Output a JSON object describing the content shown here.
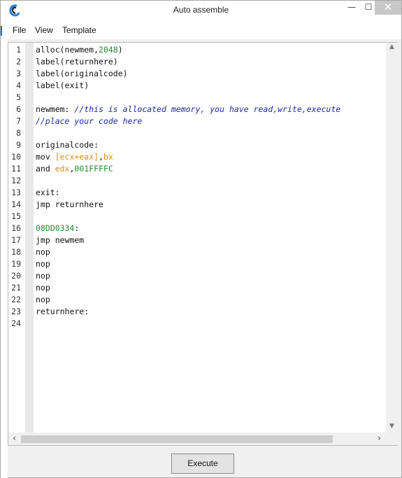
{
  "window": {
    "title": "Auto assemble",
    "min_glyph": "—",
    "max_glyph": "☐",
    "close_glyph": "✕"
  },
  "menu": [
    "File",
    "View",
    "Template"
  ],
  "editor": {
    "lines": [
      {
        "n": "1",
        "segs": [
          {
            "t": "alloc(newmem,",
            "c": "plain"
          },
          {
            "t": "2048",
            "c": "num"
          },
          {
            "t": ")",
            "c": "plain"
          }
        ]
      },
      {
        "n": "2",
        "segs": [
          {
            "t": "label(returnhere)",
            "c": "plain"
          }
        ]
      },
      {
        "n": "3",
        "segs": [
          {
            "t": "label(originalcode)",
            "c": "plain"
          }
        ]
      },
      {
        "n": "4",
        "segs": [
          {
            "t": "label(exit)",
            "c": "plain"
          }
        ]
      },
      {
        "n": "5",
        "segs": []
      },
      {
        "n": "6",
        "segs": [
          {
            "t": "newmem: ",
            "c": "plain"
          },
          {
            "t": "//this is allocated memory, you have read,write,execute",
            "c": "comment"
          }
        ]
      },
      {
        "n": "7",
        "segs": [
          {
            "t": "//place your code here",
            "c": "comment"
          }
        ]
      },
      {
        "n": "8",
        "segs": []
      },
      {
        "n": "9",
        "segs": [
          {
            "t": "originalcode:",
            "c": "plain"
          }
        ]
      },
      {
        "n": "10",
        "segs": [
          {
            "t": "mov ",
            "c": "plain"
          },
          {
            "t": "[ecx+eax]",
            "c": "reg"
          },
          {
            "t": ",",
            "c": "plain"
          },
          {
            "t": "bx",
            "c": "reg"
          }
        ]
      },
      {
        "n": "11",
        "segs": [
          {
            "t": "and ",
            "c": "plain"
          },
          {
            "t": "edx",
            "c": "reg"
          },
          {
            "t": ",",
            "c": "plain"
          },
          {
            "t": "001FFFFC",
            "c": "num"
          }
        ]
      },
      {
        "n": "12",
        "segs": []
      },
      {
        "n": "13",
        "segs": [
          {
            "t": "exit:",
            "c": "plain"
          }
        ]
      },
      {
        "n": "14",
        "segs": [
          {
            "t": "jmp returnhere",
            "c": "plain"
          }
        ]
      },
      {
        "n": "15",
        "segs": []
      },
      {
        "n": "16",
        "segs": [
          {
            "t": "08DD0334",
            "c": "addr"
          },
          {
            "t": ":",
            "c": "plain"
          }
        ]
      },
      {
        "n": "17",
        "segs": [
          {
            "t": "jmp newmem",
            "c": "plain"
          }
        ]
      },
      {
        "n": "18",
        "segs": [
          {
            "t": "nop",
            "c": "plain"
          }
        ]
      },
      {
        "n": "19",
        "segs": [
          {
            "t": "nop",
            "c": "plain"
          }
        ]
      },
      {
        "n": "20",
        "segs": [
          {
            "t": "nop",
            "c": "plain"
          }
        ]
      },
      {
        "n": "21",
        "segs": [
          {
            "t": "nop",
            "c": "plain"
          }
        ]
      },
      {
        "n": "22",
        "segs": [
          {
            "t": "nop",
            "c": "plain"
          }
        ]
      },
      {
        "n": "23",
        "segs": [
          {
            "t": "returnhere:",
            "c": "plain"
          }
        ]
      },
      {
        "n": "24",
        "segs": []
      }
    ]
  },
  "scroll": {
    "up": "▲",
    "down": "▼",
    "left": "‹",
    "right": "›"
  },
  "execute_label": "Execute",
  "icons": {
    "app": "cheat-engine-logo-icon",
    "minimize": "minimize-icon",
    "maximize": "maximize-icon",
    "close": "close-icon"
  },
  "colors": {
    "comment": "#1c2a9a",
    "number": "#1e8c2e",
    "register": "#e08a14",
    "close_button": "#c7c7c7"
  }
}
